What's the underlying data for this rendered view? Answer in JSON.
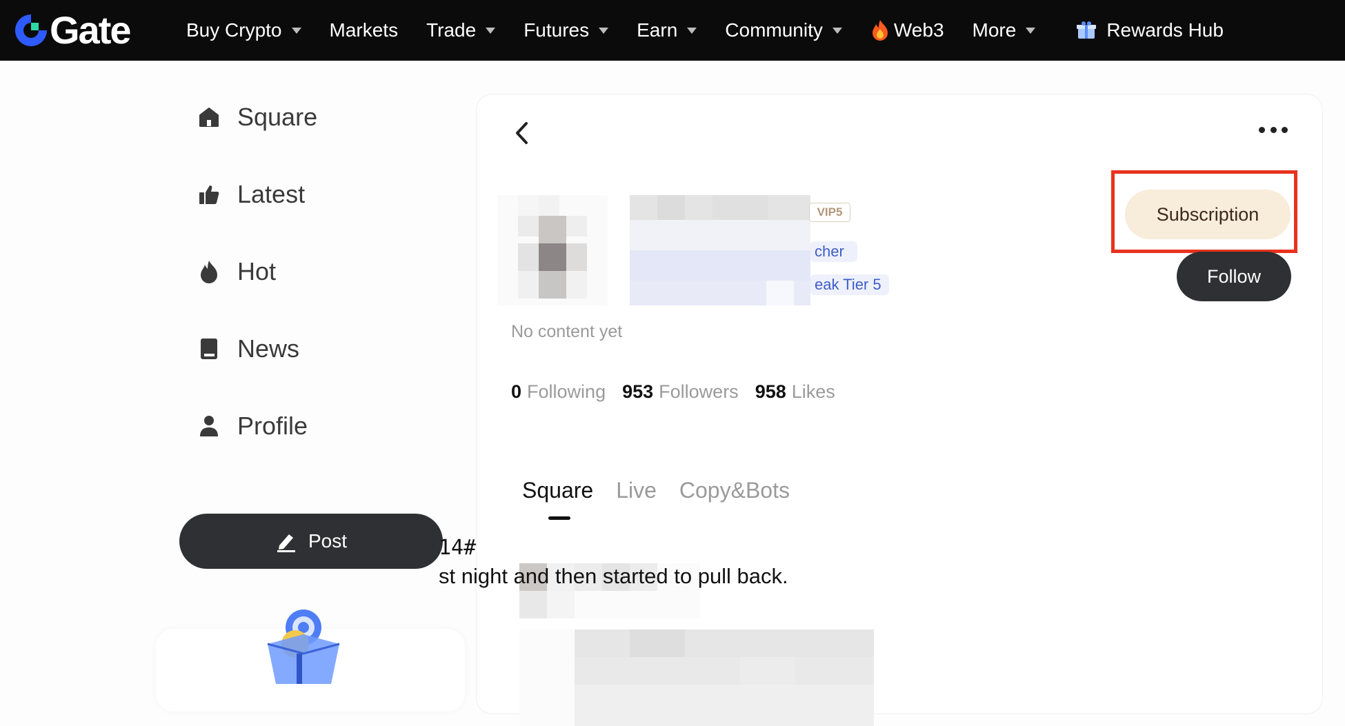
{
  "topnav": {
    "logo_text": "Gate",
    "items": [
      {
        "label": "Buy Crypto",
        "dropdown": true
      },
      {
        "label": "Markets",
        "dropdown": false
      },
      {
        "label": "Trade",
        "dropdown": true
      },
      {
        "label": "Futures",
        "dropdown": true
      },
      {
        "label": "Earn",
        "dropdown": true
      },
      {
        "label": "Community",
        "dropdown": true
      },
      {
        "label": "Web3",
        "dropdown": false,
        "icon": "fire-icon"
      },
      {
        "label": "More",
        "dropdown": true
      },
      {
        "label": "Rewards Hub",
        "dropdown": false,
        "icon": "gift-box-icon"
      }
    ]
  },
  "sidebar": {
    "items": [
      {
        "label": "Square",
        "icon": "home-icon"
      },
      {
        "label": "Latest",
        "icon": "thumbs-up-icon"
      },
      {
        "label": "Hot",
        "icon": "flame-icon"
      },
      {
        "label": "News",
        "icon": "book-icon"
      },
      {
        "label": "Profile",
        "icon": "person-icon"
      }
    ],
    "post_label": "Post"
  },
  "profile": {
    "vip_badge": "VIP5",
    "tag_1": "cher",
    "tag_2": "eak Tier 5",
    "bio": "No content yet",
    "following_count": "0",
    "following_label": "Following",
    "followers_count": "953",
    "followers_label": "Followers",
    "likes_count": "958",
    "likes_label": "Likes",
    "subscription_label": "Subscription",
    "follow_label": "Follow"
  },
  "tabs": [
    {
      "label": "Square",
      "active": true
    },
    {
      "label": "Live",
      "active": false
    },
    {
      "label": "Copy&Bots",
      "active": false
    }
  ],
  "post": {
    "line_1": "14#",
    "line_2": "st night and then started to pull back."
  },
  "colors": {
    "nav_bg": "#0b0b0b",
    "highlight_box": "#e8321e",
    "subscription_bg": "#f8ecda",
    "follow_bg": "#2f3033",
    "tag_text": "#3f5dc9"
  }
}
